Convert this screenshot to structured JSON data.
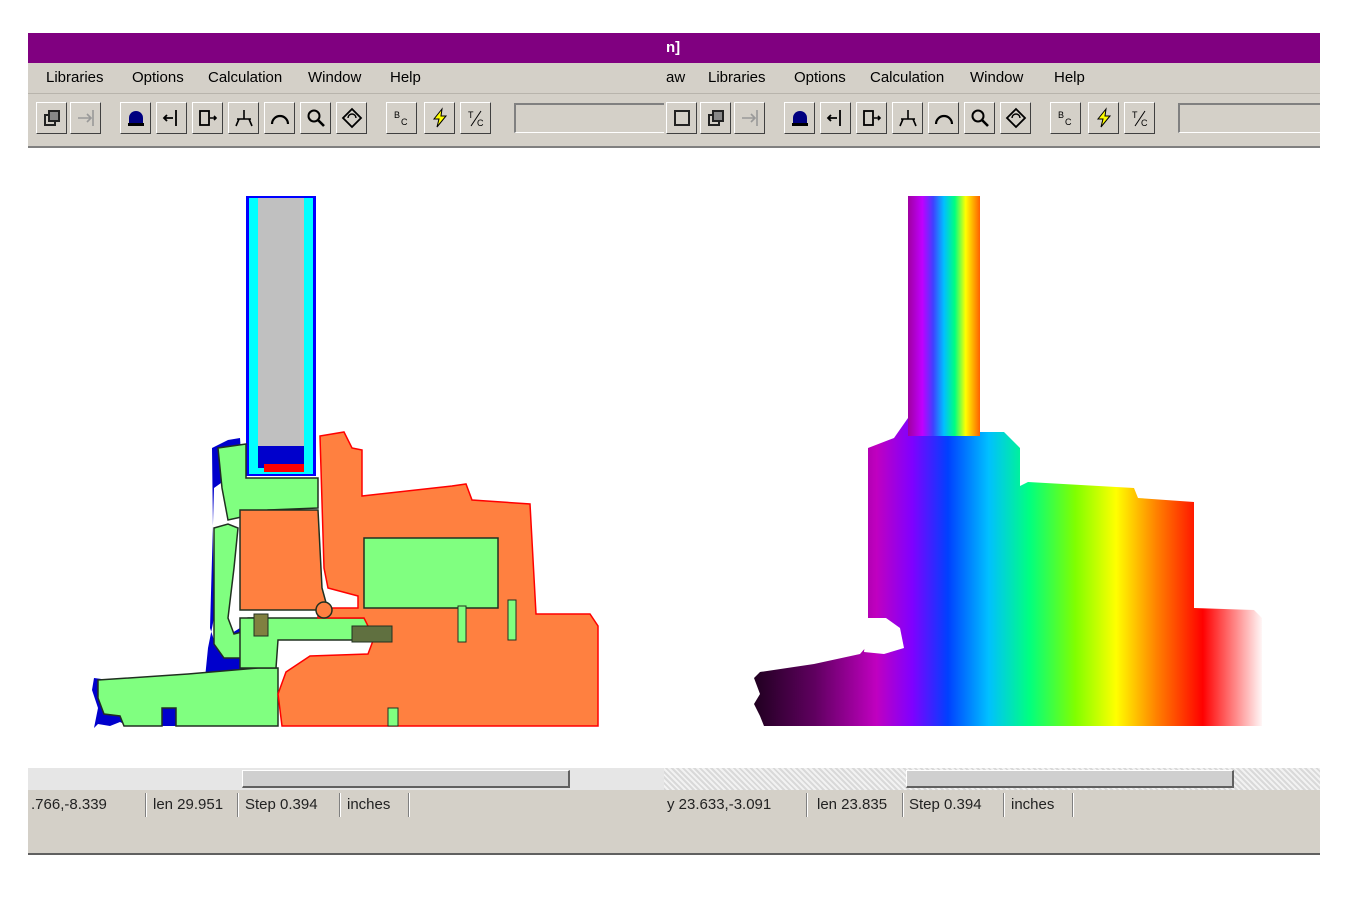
{
  "left_window": {
    "title": "",
    "menu": [
      "Libraries",
      "Options",
      "Calculation",
      "Window",
      "Help"
    ],
    "status": {
      "coords": ".766,-8.339",
      "len": "len 29.951",
      "step": "Step 0.394",
      "units": "inches"
    }
  },
  "right_window": {
    "title": "n]",
    "menu": [
      "aw",
      "Libraries",
      "Options",
      "Calculation",
      "Window",
      "Help"
    ],
    "status": {
      "coords": "y 23.633,-3.091",
      "len": "len 23.835",
      "step": "Step 0.394",
      "units": "inches"
    }
  },
  "toolbar_icons": [
    "copy-icon",
    "snap-icon",
    "dome-icon",
    "arrow-left-bar-icon",
    "arrow-right-box-icon",
    "split-icon",
    "arc-icon",
    "magnify-icon",
    "rotate-icon",
    "bc-icon",
    "lightning-icon",
    "tc-icon"
  ],
  "colors": {
    "titlebar": "#800080",
    "frame": "#d4d0c8",
    "glass": "#c0c0c0",
    "spacer_cyan": "#00ffff",
    "wood": "#ff8040",
    "polymer": "#80ff80",
    "seal": "#0000ff"
  }
}
